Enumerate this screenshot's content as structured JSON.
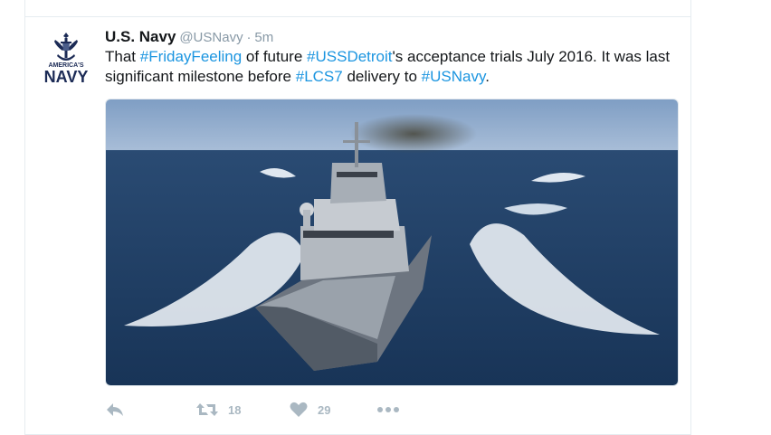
{
  "tweet": {
    "fullname": "U.S. Navy",
    "handle": "@USNavy",
    "separator": "·",
    "time": "5m",
    "text": {
      "p1": "That ",
      "tag1": "#FridayFeeling",
      "p2": " of future ",
      "tag2": "#USSDetroit",
      "p3": "'s acceptance trials July 2016. It was last significant milestone before ",
      "tag3": "#LCS7",
      "p4": " delivery to ",
      "tag4": "#USNavy",
      "p5": "."
    },
    "avatar": {
      "line1": "AMERICA'S",
      "line2": "NAVY"
    },
    "actions": {
      "reply_count": "",
      "retweet_count": "18",
      "like_count": "29"
    }
  },
  "colors": {
    "link": "#1b95e0",
    "muted": "#aab8c2",
    "navy": "#1c2b56"
  }
}
